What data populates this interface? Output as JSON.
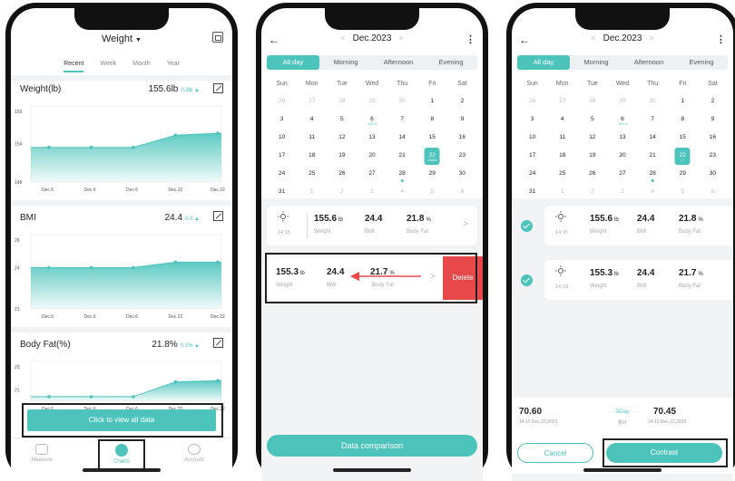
{
  "phone1": {
    "title": "Weight",
    "ranges": [
      "Recent",
      "Week",
      "Month",
      "Year"
    ],
    "cards": [
      {
        "title": "Weight(lb)",
        "value": "155.6lb",
        "delta": "0.3lb"
      },
      {
        "title": "BMI",
        "value": "24.4",
        "delta": "0.0"
      },
      {
        "title": "Body Fat(%)",
        "value": "21.8%",
        "delta": "0.1%"
      }
    ],
    "view_all_label": "Click to view all data",
    "tabs": [
      "Measure",
      "Charts",
      "Account"
    ]
  },
  "chart_data": [
    {
      "type": "area",
      "title": "Weight(lb)",
      "categories": [
        "Dec.6",
        "Dec.6",
        "Dec.6",
        "Dec.22",
        "Dec.22"
      ],
      "values": [
        153.4,
        153.4,
        153.4,
        155.3,
        155.6
      ],
      "ylim": [
        148,
        159
      ],
      "yticks": [
        "159",
        "154",
        "148"
      ]
    },
    {
      "type": "area",
      "title": "BMI",
      "categories": [
        "Dec.6",
        "Dec.6",
        "Dec.6",
        "Dec.22",
        "Dec.22"
      ],
      "values": [
        24.0,
        24.0,
        24.0,
        24.4,
        24.4
      ],
      "ylim": [
        21,
        26
      ],
      "yticks": [
        "26",
        "24",
        "21"
      ]
    },
    {
      "type": "area",
      "title": "Body Fat(%)",
      "categories": [
        "Dec.6",
        "Dec.6",
        "Dec.6",
        "Dec.22",
        "Dec.22"
      ],
      "values": [
        20.4,
        20.4,
        20.4,
        21.7,
        21.8
      ],
      "ylim": [
        20,
        23
      ],
      "yticks": [
        "23",
        "21"
      ]
    }
  ],
  "calendar": {
    "month": "Dec.2023",
    "segments": [
      "All day",
      "Morning",
      "Afternoon",
      "Evening"
    ],
    "weekdays": [
      "Sun",
      "Mon",
      "Tue",
      "Wed",
      "Thu",
      "Fri",
      "Sat"
    ],
    "days": [
      {
        "d": "26",
        "m": true
      },
      {
        "d": "27",
        "m": true
      },
      {
        "d": "28",
        "m": true
      },
      {
        "d": "29",
        "m": true
      },
      {
        "d": "30",
        "m": true
      },
      {
        "d": "1"
      },
      {
        "d": "2"
      },
      {
        "d": "3"
      },
      {
        "d": "4"
      },
      {
        "d": "5"
      },
      {
        "d": "6",
        "sub": "153.4"
      },
      {
        "d": "7"
      },
      {
        "d": "8"
      },
      {
        "d": "9"
      },
      {
        "d": "10"
      },
      {
        "d": "11"
      },
      {
        "d": "12"
      },
      {
        "d": "13"
      },
      {
        "d": "14"
      },
      {
        "d": "15"
      },
      {
        "d": "16"
      },
      {
        "d": "17"
      },
      {
        "d": "18"
      },
      {
        "d": "19"
      },
      {
        "d": "20"
      },
      {
        "d": "21"
      },
      {
        "d": "22",
        "sel": true,
        "sub": "155.6"
      },
      {
        "d": "23"
      },
      {
        "d": "24"
      },
      {
        "d": "25"
      },
      {
        "d": "26"
      },
      {
        "d": "27"
      },
      {
        "d": "28",
        "dot": true
      },
      {
        "d": "29"
      },
      {
        "d": "30"
      },
      {
        "d": "31"
      },
      {
        "d": "1",
        "m": true
      },
      {
        "d": "2",
        "m": true
      },
      {
        "d": "3",
        "m": true
      },
      {
        "d": "4",
        "m": true
      },
      {
        "d": "5",
        "m": true
      },
      {
        "d": "6",
        "m": true
      }
    ]
  },
  "phone3_sub": {
    "sel_sub": "✓"
  },
  "records": [
    {
      "time": "14:15",
      "weight": "155.6",
      "weight_unit": "lb",
      "bmi": "24.4",
      "fat": "21.8",
      "fat_unit": "%"
    },
    {
      "time": "14:10",
      "weight": "155.3",
      "weight_unit": "lb",
      "bmi": "24.4",
      "fat": "21.7",
      "fat_unit": "%"
    }
  ],
  "labels": {
    "weight": "Weight",
    "bmi": "BMI",
    "fat": "Body Fat",
    "delete": "Delete",
    "data_comparison": "Data comparison",
    "cancel": "Cancel",
    "contrast": "Contrast"
  },
  "compare": {
    "left_val": "70.60",
    "left_ts": "14:15 Dec.22,2023",
    "mid": "· · 0Day · ·",
    "mid_sub": "累计",
    "right_val": "70.45",
    "right_ts": "14:10 Dec.22,2023"
  }
}
